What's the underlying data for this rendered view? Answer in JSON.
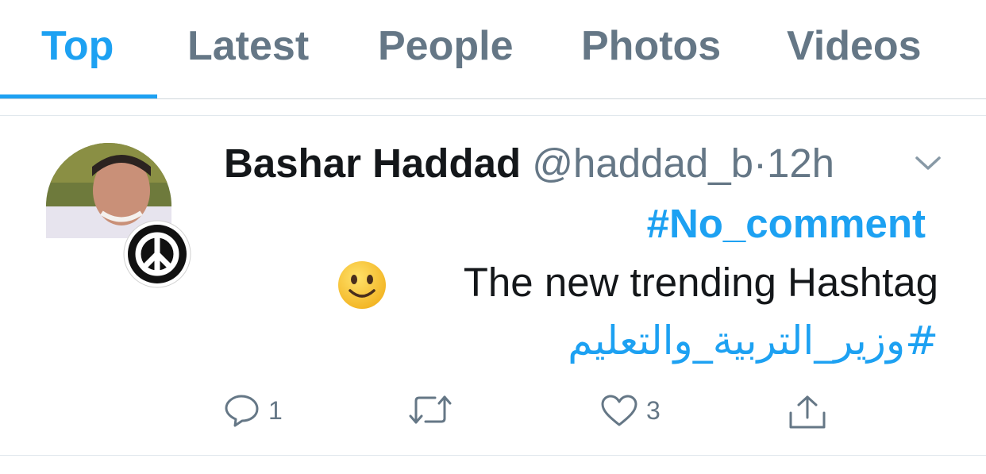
{
  "tabs": [
    {
      "label": "Top",
      "active": true
    },
    {
      "label": "Latest",
      "active": false
    },
    {
      "label": "People",
      "active": false
    },
    {
      "label": "Photos",
      "active": false
    },
    {
      "label": "Videos",
      "active": false
    }
  ],
  "tweet": {
    "author_name": "Bashar Haddad",
    "handle": "@haddad_b",
    "separator": "·",
    "time": "12h",
    "menu_icon": "chevron-down-icon",
    "hashtag": "#No_comment",
    "body_text": "The new trending Hashtag",
    "emoji": "slightly-smiling-face",
    "arabic_hashtag": "#وزير_التربية_والتعليم",
    "actions": {
      "reply_count": "1",
      "retweet_count": "",
      "like_count": "3"
    }
  },
  "colors": {
    "accent": "#1da1f2",
    "text": "#14171a",
    "muted": "#657786"
  }
}
